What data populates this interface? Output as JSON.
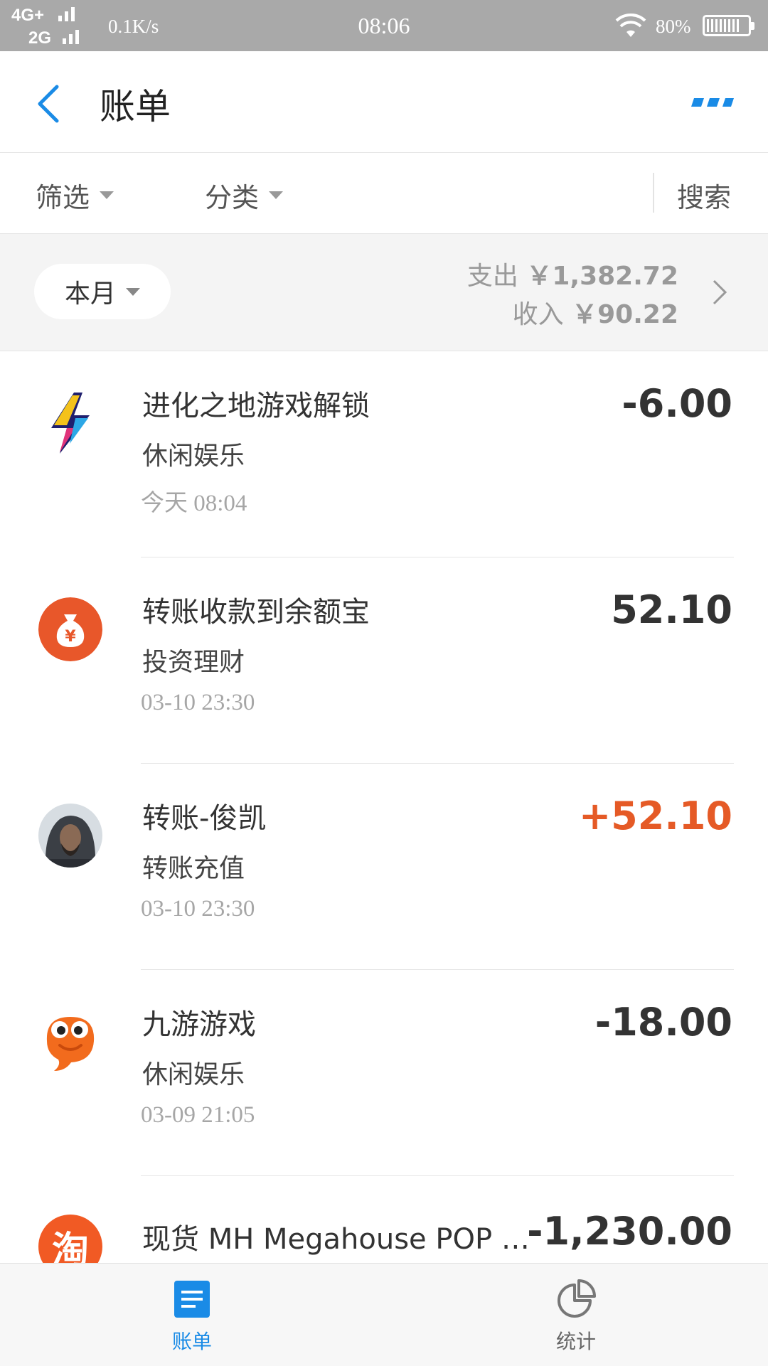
{
  "status_bar": {
    "network_top": "4G+",
    "network_bottom": "2G",
    "speed": "0.1K/s",
    "time": "08:06",
    "battery": "80%"
  },
  "app_bar": {
    "title": "账单"
  },
  "filter_bar": {
    "filter_label": "筛选",
    "category_label": "分类",
    "search_label": "搜索"
  },
  "summary": {
    "period": "本月",
    "expense_label": "支出",
    "expense_amount": "￥1,382.72",
    "income_label": "收入",
    "income_amount": "￥90.22"
  },
  "transactions": [
    {
      "title": "进化之地游戏解锁",
      "category": "休闲娱乐",
      "time": "今天  08:04",
      "amount": "-6.00",
      "icon": "lightning-icon"
    },
    {
      "title": "转账收款到余额宝",
      "category": "投资理财",
      "time": "03-10  23:30",
      "amount": "52.10",
      "icon": "money-bag-icon"
    },
    {
      "title": "转账-俊凯",
      "category": "转账充值",
      "time": "03-10  23:30",
      "amount": "+52.10",
      "icon": "user-avatar"
    },
    {
      "title": "九游游戏",
      "category": "休闲娱乐",
      "time": "03-09  21:05",
      "amount": "-18.00",
      "icon": "jiuyou-icon"
    },
    {
      "title": "现货 MH Megahouse POP …",
      "category": "",
      "time": "",
      "amount": "-1,230.00",
      "icon": "taobao-icon",
      "icon_text": "淘"
    }
  ],
  "bottom_nav": {
    "bills_label": "账单",
    "stats_label": "统计"
  },
  "colors": {
    "accent_blue": "#1a8be6",
    "income_orange": "#e55a26"
  }
}
